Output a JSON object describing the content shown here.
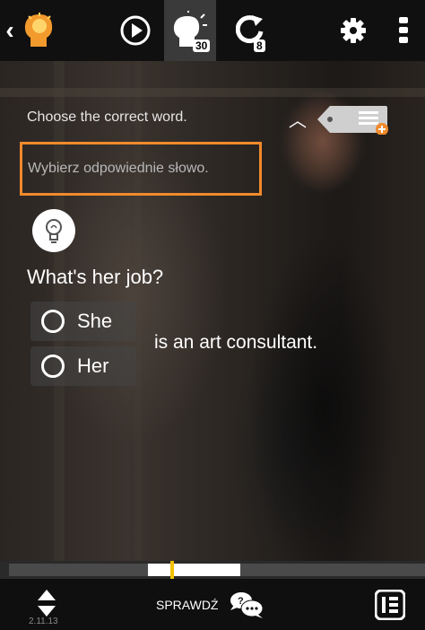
{
  "topbar": {
    "hint_count": "30",
    "repeat_count": "8"
  },
  "exercise": {
    "instruction_en": "Choose the correct word.",
    "instruction_pl": "Wybierz odpowiednie słowo.",
    "question": "What's her job?",
    "options": [
      {
        "label": "She"
      },
      {
        "label": "Her"
      }
    ],
    "sentence_rest": "is an art consultant."
  },
  "progress": {
    "value": 0.41
  },
  "bottombar": {
    "check_label": "SPRAWDŹ",
    "version": "2.11.13"
  },
  "colors": {
    "accent": "#f08a2c",
    "progress_marker": "#f2c200"
  }
}
